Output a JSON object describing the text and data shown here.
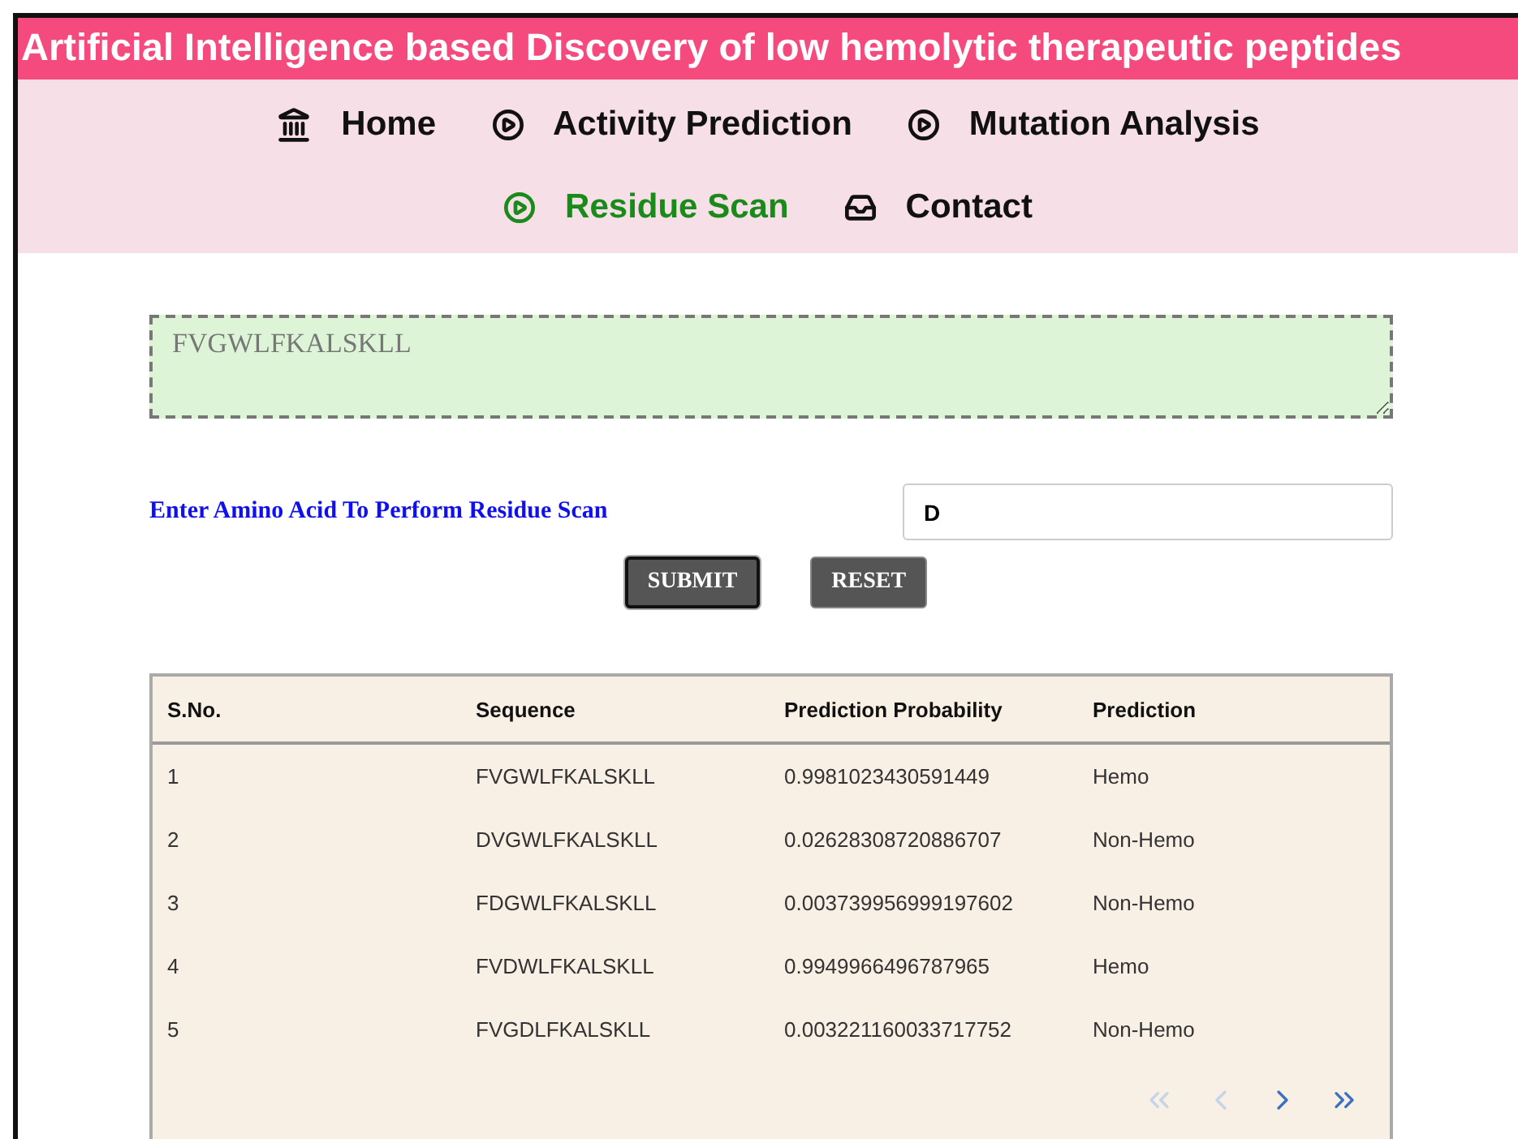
{
  "title": "Artificial Intelligence based Discovery of low hemolytic therapeutic peptides",
  "nav": [
    {
      "label": "Home",
      "kind": "home",
      "selected": false
    },
    {
      "label": "Activity Prediction",
      "kind": "page",
      "selected": false
    },
    {
      "label": "Mutation Analysis",
      "kind": "page",
      "selected": false
    },
    {
      "label": "Residue Scan",
      "kind": "page",
      "selected": true
    },
    {
      "label": "Contact",
      "kind": "contact",
      "selected": false
    }
  ],
  "sequence_field": {
    "value": "FVGWLFKALSKLL"
  },
  "amino_acid": {
    "label": "Enter Amino Acid To Perform Residue Scan",
    "value": "D"
  },
  "buttons": [
    {
      "label": "SUBMIT",
      "focused": true
    },
    {
      "label": "RESET",
      "focused": false
    }
  ],
  "table": {
    "columns": [
      "S.No.",
      "Sequence",
      "Prediction Probability",
      "Prediction"
    ],
    "rows": [
      [
        "1",
        "FVGWLFKALSKLL",
        "0.9981023430591449",
        "Hemo"
      ],
      [
        "2",
        "DVGWLFKALSKLL",
        "0.02628308720886707",
        "Non-Hemo"
      ],
      [
        "3",
        "FDGWLFKALSKLL",
        "0.003739956999197602",
        "Non-Hemo"
      ],
      [
        "4",
        "FVDWLFKALSKLL",
        "0.9949966496787965",
        "Hemo"
      ],
      [
        "5",
        "FVGDLFKALSKLL",
        "0.003221160033717752",
        "Non-Hemo"
      ]
    ]
  },
  "pagination": [
    {
      "kind": "first",
      "disabled": true
    },
    {
      "kind": "prev",
      "disabled": true
    },
    {
      "kind": "next",
      "disabled": false
    },
    {
      "kind": "last",
      "disabled": false
    }
  ]
}
